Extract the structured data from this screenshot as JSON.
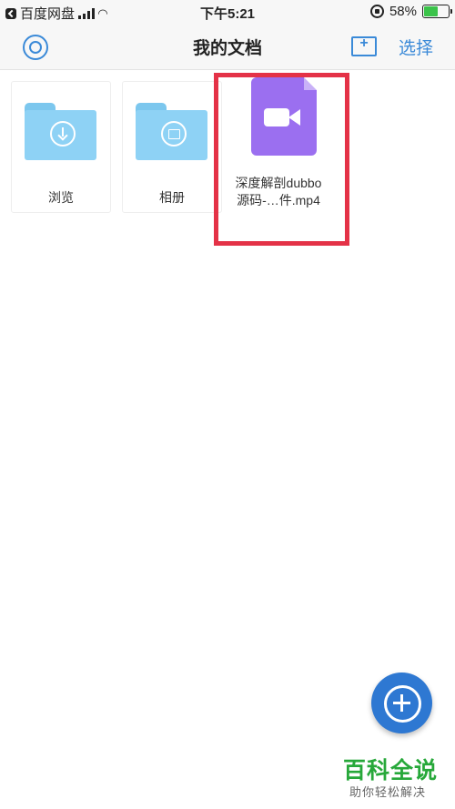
{
  "status_bar": {
    "carrier": "百度网盘",
    "time": "下午5:21",
    "battery_percent": "58%",
    "battery_level": 0.58,
    "battery_color": "#3bc34a"
  },
  "nav": {
    "title": "我的文档",
    "select_label": "选择",
    "accent_color": "#3b8ad8"
  },
  "items": [
    {
      "type": "folder",
      "label": "浏览",
      "icon": "download-icon"
    },
    {
      "type": "folder",
      "label": "相册",
      "icon": "image-icon"
    },
    {
      "type": "file",
      "label_line1": "深度解剖dubbo",
      "label_line2": "源码-…件.mp4",
      "icon": "video-icon",
      "file_color": "#9b6ff0",
      "highlighted": true
    }
  ],
  "fab": {
    "icon": "plus-icon",
    "color": "#2e78d2"
  },
  "watermark": {
    "title": "百科全说",
    "subtitle": "助你轻松解决"
  }
}
